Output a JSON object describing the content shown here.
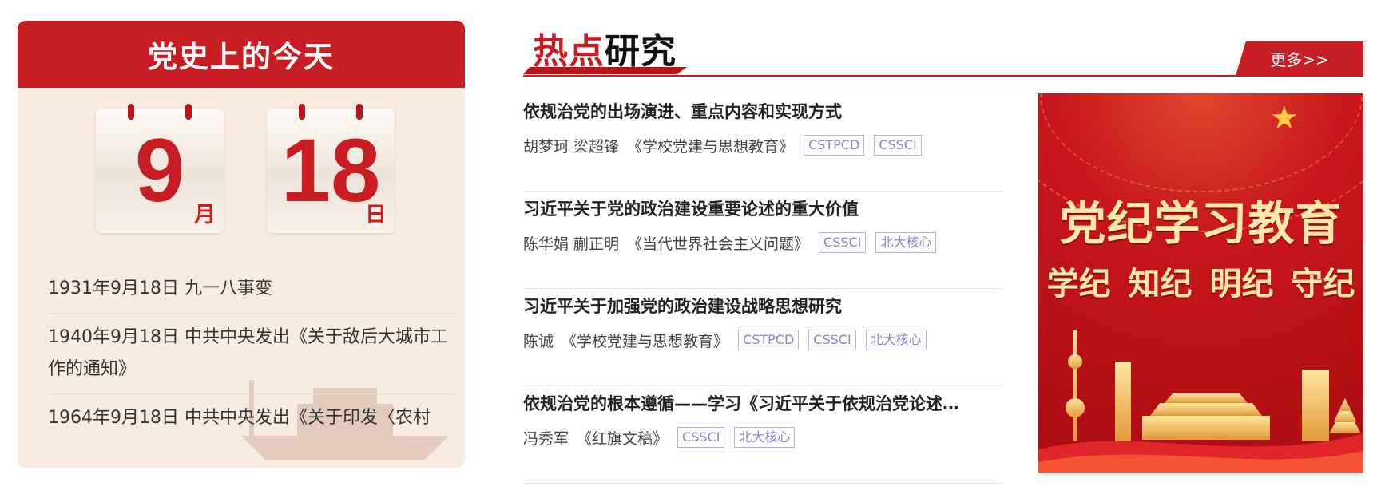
{
  "today": {
    "title": "党史上的今天",
    "month": "9",
    "month_unit": "月",
    "day": "18",
    "day_unit": "日",
    "events": [
      "1931年9月18日 九一八事变",
      "1940年9月18日 中共中央发出《关于敌后大城市工作的通知》",
      "1964年9月18日 中共中央发出《关于印发〈农村"
    ]
  },
  "hot": {
    "title_red": "热点",
    "title_dark": "研究",
    "more_label": "更多>>",
    "articles": [
      {
        "title": "依规治党的出场演进、重点内容和实现方式",
        "authors": "胡梦珂 梁超锋",
        "journal": "《学校党建与思想教育》",
        "tags": [
          "CSTPCD",
          "CSSCI"
        ]
      },
      {
        "title": "习近平关于党的政治建设重要论述的重大价值",
        "authors": "陈华娟 蒯正明",
        "journal": "《当代世界社会主义问题》",
        "tags": [
          "CSSCI",
          "北大核心"
        ]
      },
      {
        "title": "习近平关于加强党的政治建设战略思想研究",
        "authors": "陈诚",
        "journal": "《学校党建与思想教育》",
        "tags": [
          "CSTPCD",
          "CSSCI",
          "北大核心"
        ]
      },
      {
        "title": "依规治党的根本遵循——学习《习近平关于依规治党论述…",
        "authors": "冯秀军",
        "journal": "《红旗文稿》",
        "tags": [
          "CSSCI",
          "北大核心"
        ]
      }
    ]
  },
  "banner": {
    "title": "党纪学习教育",
    "subtitle": "学纪 知纪 明纪 守纪"
  },
  "colors": {
    "brand_red": "#c81d22",
    "tag_purple": "#8a84d8",
    "card_bg": "#f8ece0",
    "banner_gold": "#ffe8a8"
  }
}
